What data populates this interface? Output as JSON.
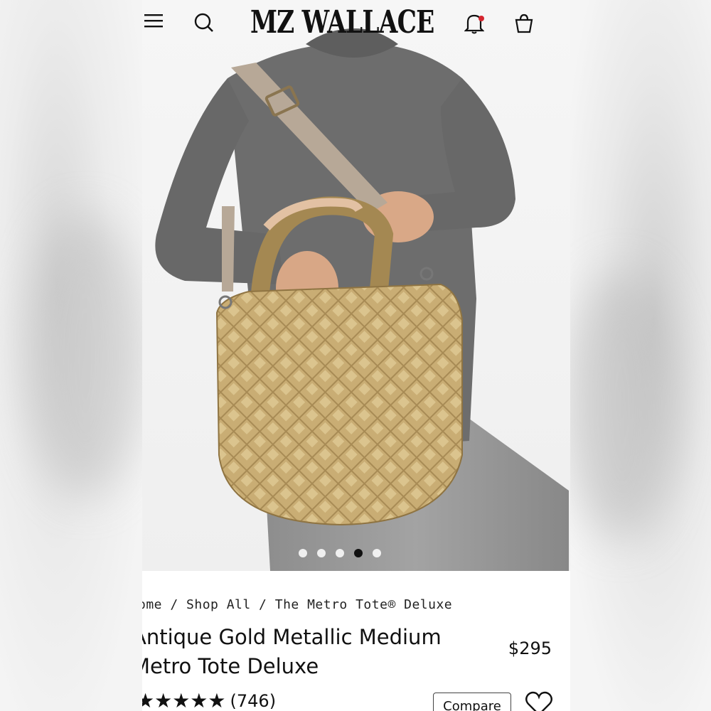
{
  "header": {
    "brand": "MZ WALLACE",
    "menu_icon": "hamburger-menu-icon",
    "search_icon": "search-icon",
    "bell_icon": "bell-icon",
    "bag_icon": "shopping-bag-icon"
  },
  "gallery": {
    "total_slides": 5,
    "active_slide": 4
  },
  "breadcrumb": {
    "text": "ome / Shop All / The Metro Tote® Deluxe"
  },
  "product": {
    "title": "Antique Gold Metallic Medium Metro Tote Deluxe",
    "price": "$295",
    "stars": "★★★★★",
    "rating_count": "(746)",
    "compare_label": "Compare",
    "wishlist_icon": "heart-icon"
  },
  "colors": {
    "accent_red": "#d4252e",
    "gold": "#b79a63",
    "sweater": "#6d6d6d"
  }
}
